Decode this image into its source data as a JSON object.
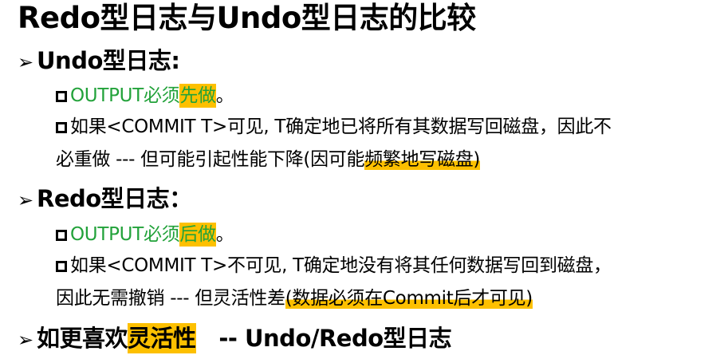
{
  "title": "Redo型日志与Undo型日志的比较",
  "undo": {
    "heading": "Undo型日志:",
    "item1_prefix": "OUTPUT必须",
    "item1_highlight": "先做",
    "item1_suffix": "。",
    "item2_line1": "如果<COMMIT T>可见, T确定地已将所有其数据写回磁盘，因此不",
    "item2_line2_plain": "必重做 --- 但可能引起性能下降(因可能",
    "item2_line2_underlined": "频繁地写磁盘)"
  },
  "redo": {
    "heading": "Redo型日志：",
    "item1_prefix": "OUTPUT必须",
    "item1_highlight": "后做",
    "item1_suffix": "。",
    "item2_line1": "如果<COMMIT T>不可见, T确定地没有将其任何数据写回到磁盘，",
    "item2_line2_plain": "因此无需撤销 --- 但灵活性差",
    "item2_line2_underlined": "(数据必须在Commit后才可见)"
  },
  "conclusion": {
    "prefix": "如更喜欢",
    "highlight": "灵活性",
    "suffix": "   -- Undo/Redo型日志"
  },
  "colors": {
    "highlight": "#fdc000",
    "green_text": "#22a23a"
  },
  "icons": {
    "bullet_arrow": "➢",
    "bullet_box": "hollow-square"
  }
}
